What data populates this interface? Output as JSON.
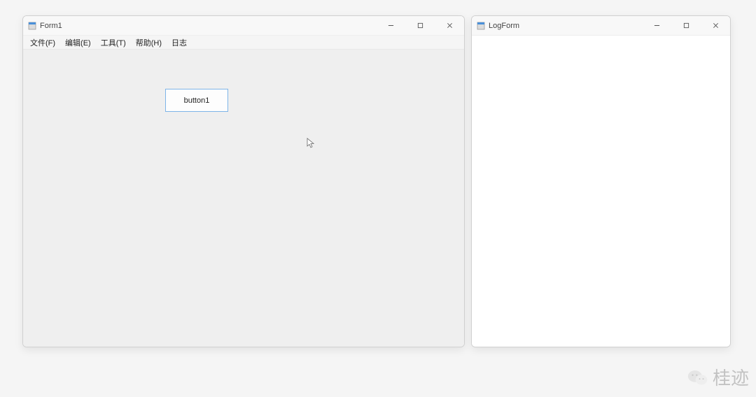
{
  "form1": {
    "title": "Form1",
    "menu": {
      "file": "文件(F)",
      "edit": "编辑(E)",
      "tools": "工具(T)",
      "help": "帮助(H)",
      "log": "日志"
    },
    "button1_label": "button1"
  },
  "logform": {
    "title": "LogForm"
  },
  "watermark": {
    "text": "桂迹"
  }
}
